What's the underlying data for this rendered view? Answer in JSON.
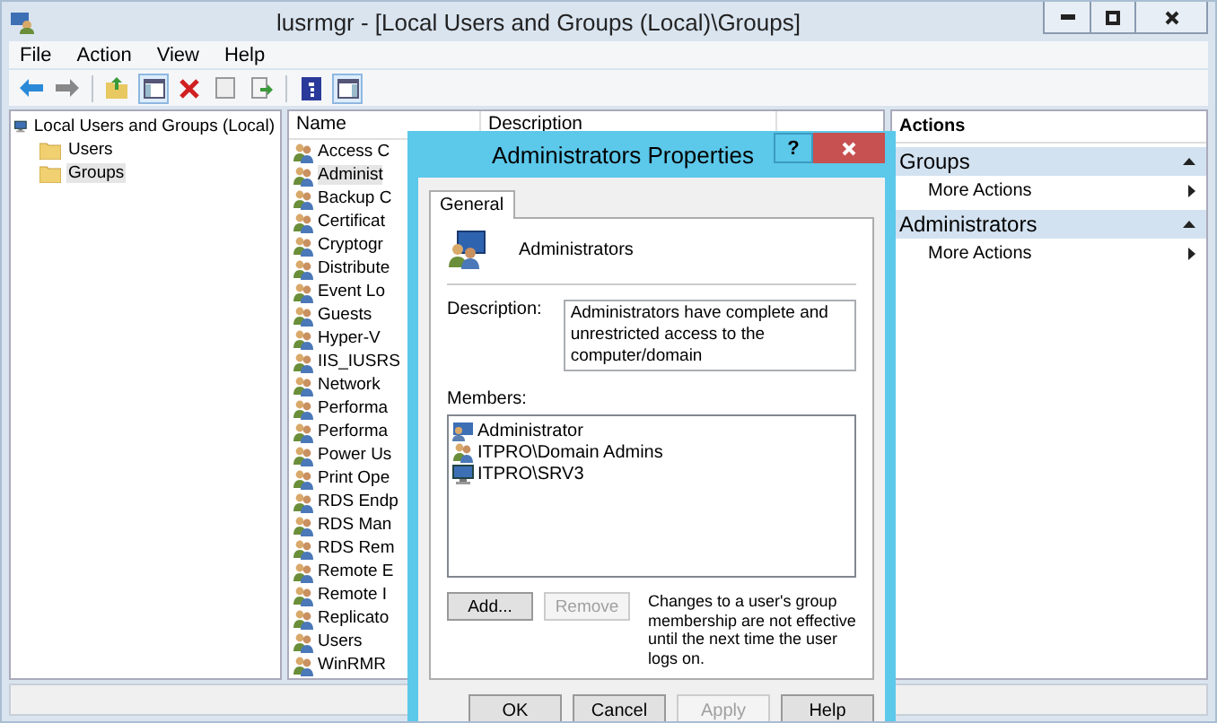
{
  "window": {
    "title": "lusrmgr - [Local Users and Groups (Local)\\Groups]"
  },
  "menu": [
    "File",
    "Action",
    "View",
    "Help"
  ],
  "tree": {
    "label": "Local Users and Groups (Local)",
    "children": [
      {
        "label": "Users",
        "selected": false
      },
      {
        "label": "Groups",
        "selected": true
      }
    ]
  },
  "list": {
    "columns": [
      "Name",
      "Description"
    ],
    "rows": [
      {
        "name": "Access C",
        "selected": false
      },
      {
        "name": "Administ",
        "selected": true
      },
      {
        "name": "Backup C",
        "selected": false
      },
      {
        "name": "Certificat",
        "selected": false
      },
      {
        "name": "Cryptogr",
        "selected": false
      },
      {
        "name": "Distribute",
        "selected": false
      },
      {
        "name": "Event Lo",
        "selected": false
      },
      {
        "name": "Guests",
        "selected": false
      },
      {
        "name": "Hyper-V",
        "selected": false
      },
      {
        "name": "IIS_IUSRS",
        "selected": false
      },
      {
        "name": "Network",
        "selected": false
      },
      {
        "name": "Performa",
        "selected": false
      },
      {
        "name": "Performa",
        "selected": false
      },
      {
        "name": "Power Us",
        "selected": false
      },
      {
        "name": "Print Ope",
        "selected": false
      },
      {
        "name": "RDS Endp",
        "selected": false
      },
      {
        "name": "RDS Man",
        "selected": false
      },
      {
        "name": "RDS Rem",
        "selected": false
      },
      {
        "name": "Remote E",
        "selected": false
      },
      {
        "name": "Remote I",
        "selected": false
      },
      {
        "name": "Replicato",
        "selected": false
      },
      {
        "name": "Users",
        "selected": false
      },
      {
        "name": "WinRMR",
        "selected": false
      }
    ]
  },
  "actions": {
    "title": "Actions",
    "sections": [
      {
        "title": "Groups",
        "items": [
          "More Actions"
        ]
      },
      {
        "title": "Administrators",
        "items": [
          "More Actions"
        ]
      }
    ]
  },
  "dialog": {
    "title": "Administrators Properties",
    "help_glyph": "?",
    "tabs": [
      {
        "label": "General",
        "selected": true
      }
    ],
    "group_name": "Administrators",
    "description_label": "Description:",
    "description": "Administrators have complete and unrestricted access to the computer/domain",
    "members_label": "Members:",
    "members": [
      {
        "name": "Administrator",
        "kind": "user"
      },
      {
        "name": "ITPRO\\Domain Admins",
        "kind": "group"
      },
      {
        "name": "ITPRO\\SRV3",
        "kind": "computer"
      }
    ],
    "member_buttons": [
      {
        "label": "Add...",
        "disabled": false
      },
      {
        "label": "Remove",
        "disabled": true
      }
    ],
    "note": "Changes to a user's group membership are not effective until the next time the user logs on.",
    "buttons": [
      {
        "label": "OK",
        "disabled": false
      },
      {
        "label": "Cancel",
        "disabled": false
      },
      {
        "label": "Apply",
        "disabled": true
      },
      {
        "label": "Help",
        "disabled": false
      }
    ]
  }
}
